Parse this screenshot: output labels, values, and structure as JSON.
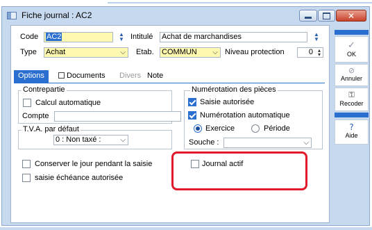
{
  "window": {
    "title": "Fiche journal : AC2"
  },
  "header": {
    "code_label": "Code",
    "code_value": "AC2",
    "intitule_label": "Intitulé",
    "intitule_value": "Achat de marchandises",
    "type_label": "Type",
    "type_value": "Achat",
    "etab_label": "Etab.",
    "etab_value": "COMMUN",
    "niveau_label": "Niveau protection",
    "niveau_value": "0"
  },
  "tabs": [
    {
      "label": "Options",
      "state": "active"
    },
    {
      "label": "Documents",
      "state": "normal"
    },
    {
      "label": "Divers",
      "state": "disabled"
    },
    {
      "label": "Note",
      "state": "normal"
    }
  ],
  "contrepartie": {
    "legend": "Contrepartie",
    "calcul_label": "Calcul automatique",
    "calcul_checked": false,
    "compte_label": "Compte",
    "compte_value": ""
  },
  "tva": {
    "legend": "T.V.A. par défaut",
    "value": "0 : Non taxé :"
  },
  "numerotation": {
    "legend": "Numérotation des pièces",
    "saisie_label": "Saisie autorisée",
    "saisie_checked": true,
    "auto_label": "Numérotation automatique",
    "auto_checked": true,
    "exercice_label": "Exercice",
    "exercice_selected": true,
    "periode_label": "Période",
    "periode_selected": false,
    "souche_label": "Souche :",
    "souche_value": ""
  },
  "options": {
    "conserver_label": "Conserver le jour pendant la saisie",
    "conserver_checked": false,
    "echeance_label": "saisie échéance autorisée",
    "echeance_checked": false,
    "journal_actif_label": "Journal actif",
    "journal_actif_checked": false
  },
  "side_buttons": [
    {
      "label": "OK",
      "icon": "check-icon"
    },
    {
      "label": "Annuler",
      "icon": "cancel-icon"
    },
    {
      "label": "Recoder",
      "icon": "key-icon"
    },
    {
      "label": "Aide",
      "icon": "help-icon"
    }
  ],
  "colors": {
    "accent": "#2a6fcf",
    "highlight": "#e0192b",
    "window_bg": "#c7d9ee",
    "required_field": "#fff8b0"
  }
}
